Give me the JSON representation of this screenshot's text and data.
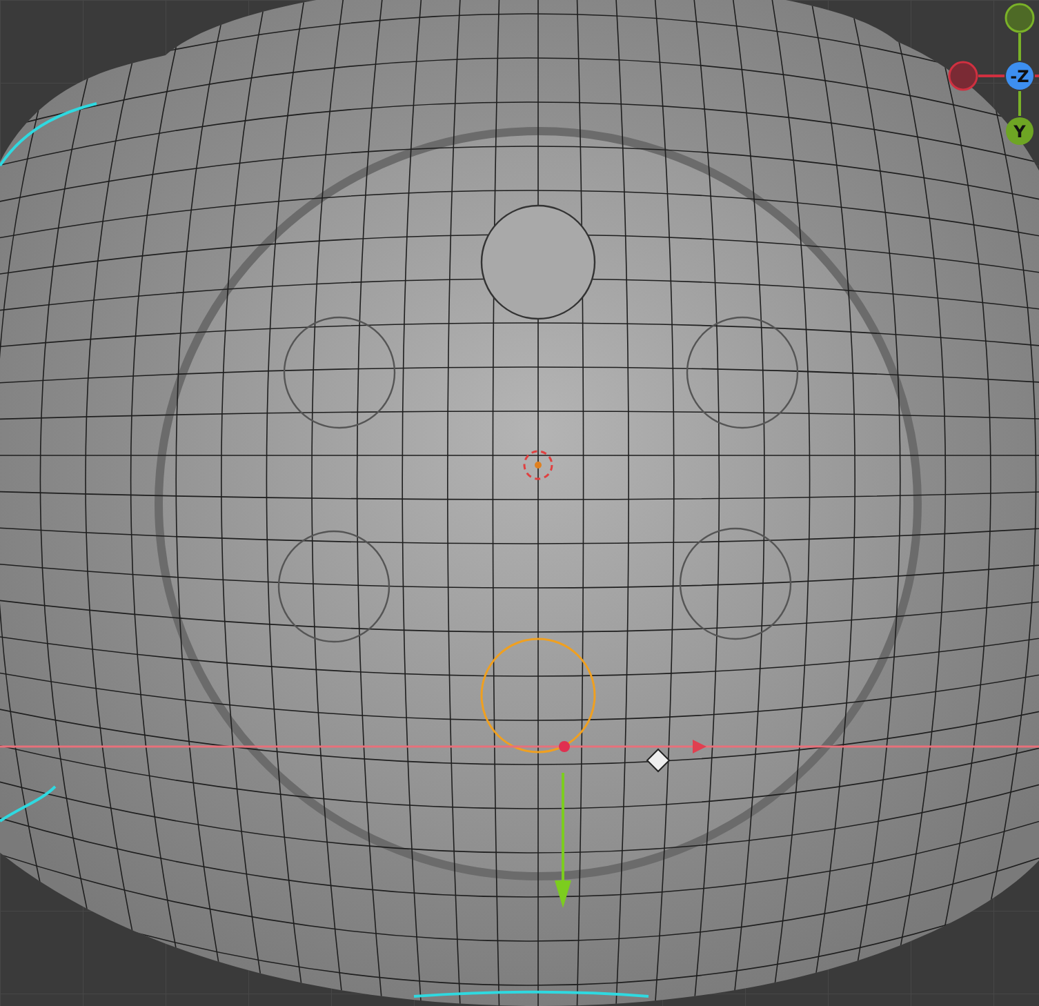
{
  "navigation_gizmo": {
    "axes": [
      {
        "label": "-Z",
        "color": "#3d8ff0"
      },
      {
        "label": "Y",
        "color": "#6ea524"
      }
    ]
  }
}
